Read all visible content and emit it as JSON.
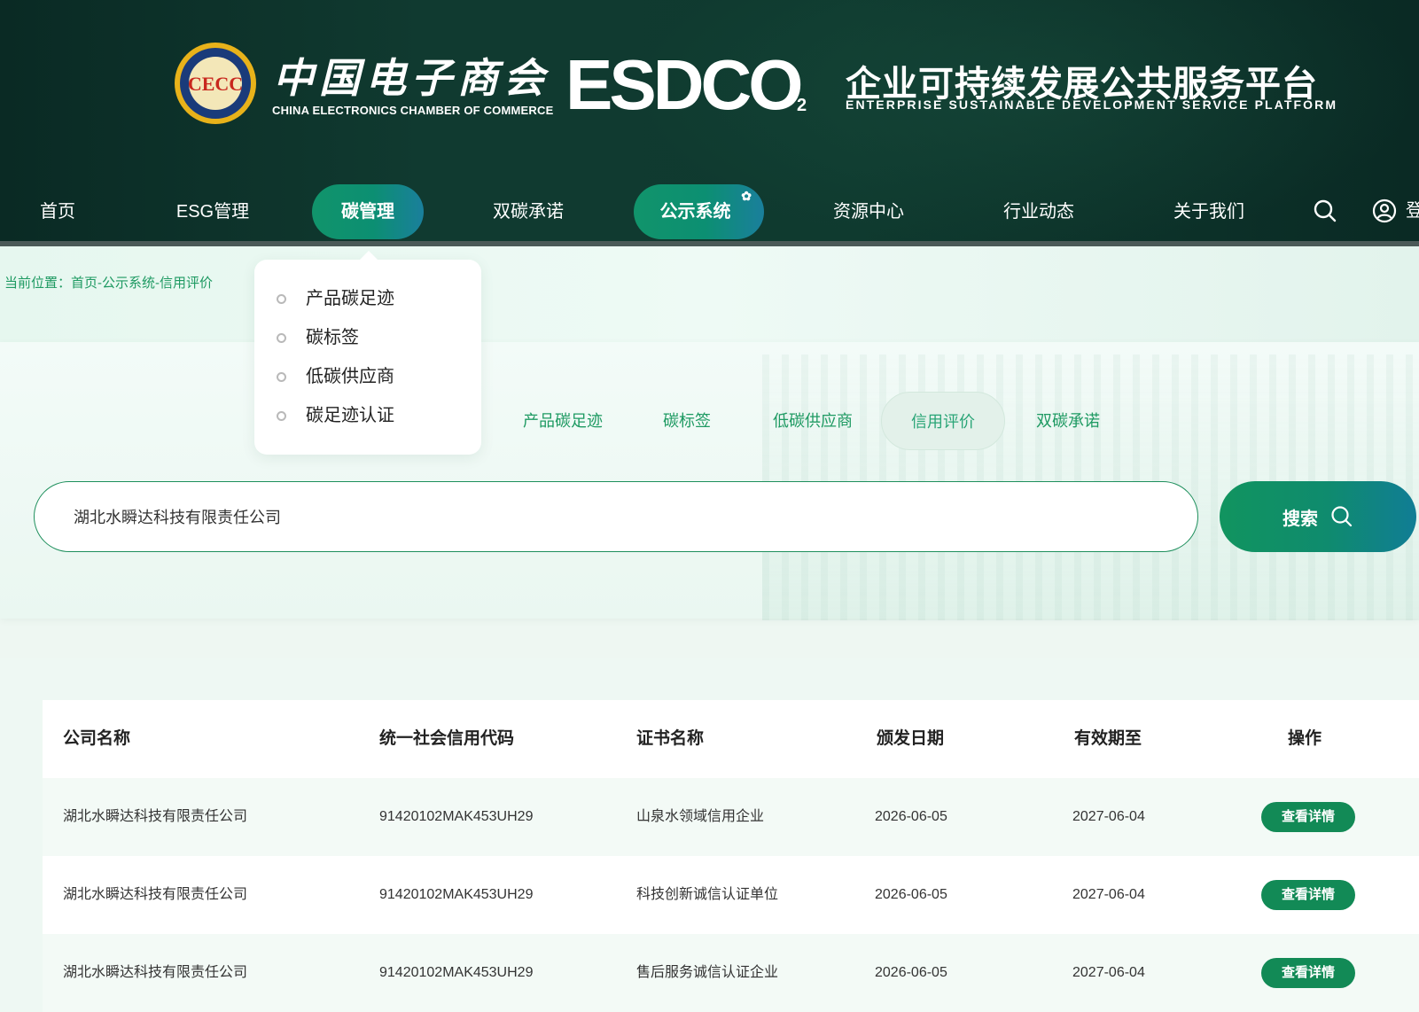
{
  "header": {
    "org_name_cn": "中国电子商会",
    "org_name_en": "CHINA ELECTRONICS CHAMBER OF COMMERCE",
    "brand_main": "ESDCO",
    "brand_sub": "2",
    "platform_title": "企业可持续发展公共服务平台",
    "platform_sub": "ENTERPRISE SUSTAINABLE DEVELOPMENT SERVICE PLATFORM"
  },
  "nav": {
    "items": [
      {
        "label": "首页"
      },
      {
        "label": "ESG管理"
      },
      {
        "label": "碳管理"
      },
      {
        "label": "双碳承诺"
      },
      {
        "label": "公示系统"
      },
      {
        "label": "资源中心"
      },
      {
        "label": "行业动态"
      },
      {
        "label": "关于我们"
      }
    ],
    "login_label": "登"
  },
  "breadcrumb": "当前位置：首页-公示系统-信用评价",
  "dropdown": {
    "items": [
      {
        "label": "产品碳足迹"
      },
      {
        "label": "碳标签"
      },
      {
        "label": "低碳供应商"
      },
      {
        "label": "碳足迹认证"
      }
    ]
  },
  "sub_tabs": [
    {
      "label": "产品碳足迹"
    },
    {
      "label": "碳标签"
    },
    {
      "label": "低碳供应商"
    },
    {
      "label": "信用评价",
      "active": true
    },
    {
      "label": "双碳承诺"
    }
  ],
  "search": {
    "value": "湖北水瞬达科技有限责任公司",
    "button_label": "搜索"
  },
  "table": {
    "headers": [
      "公司名称",
      "统一社会信用代码",
      "证书名称",
      "颁发日期",
      "有效期至",
      "操作"
    ],
    "rows": [
      {
        "company": "湖北水瞬达科技有限责任公司",
        "code": "91420102MAK453UH29",
        "cert": "山泉水领域信用企业",
        "issued": "2026-06-05",
        "valid": "2027-06-04",
        "action": "查看详情"
      },
      {
        "company": "湖北水瞬达科技有限责任公司",
        "code": "91420102MAK453UH29",
        "cert": "科技创新诚信认证单位",
        "issued": "2026-06-05",
        "valid": "2027-06-04",
        "action": "查看详情"
      },
      {
        "company": "湖北水瞬达科技有限责任公司",
        "code": "91420102MAK453UH29",
        "cert": "售后服务诚信认证企业",
        "issued": "2026-06-05",
        "valid": "2027-06-04",
        "action": "查看详情"
      }
    ]
  },
  "colors": {
    "header_bg": "#0f3a2f",
    "accent_green": "#128a56",
    "link_green": "#1e9a62",
    "pill_gradient_end": "#107d95"
  },
  "icons": {
    "search": "search-icon",
    "user": "user-circle-icon",
    "badge": "flower-badge-icon"
  }
}
